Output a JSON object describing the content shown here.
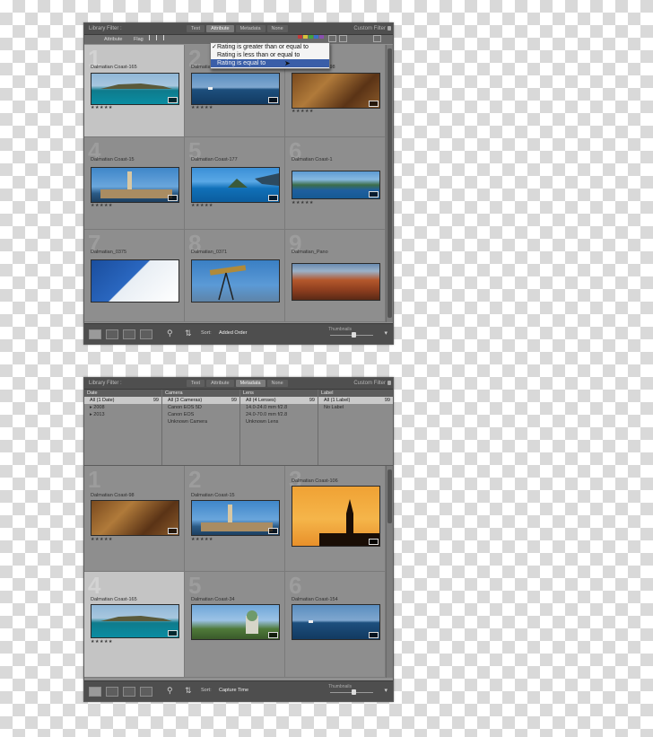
{
  "colors": {
    "panel": "#909090",
    "selected_row": "#3a5ea8",
    "selected_cell": "#c4c4c4",
    "toolbar": "#4e4e4e"
  },
  "top_panel": {
    "filter_title": "Library Filter :",
    "tabs": [
      "Text",
      "Attribute",
      "Metadata",
      "None"
    ],
    "active_tab": "Attribute",
    "preset": "Custom Filter",
    "attribute_bar": {
      "label": "Attribute",
      "flag_label": "Flag",
      "rating_label": "Rating"
    },
    "rating_menu": {
      "items": [
        "Rating is greater than or equal to",
        "Rating is less than or equal to",
        "Rating is equal to"
      ],
      "checked_index": 0,
      "selected_index": 2
    },
    "cells": [
      {
        "index": "1",
        "name": "Dalmatian Coast-165",
        "stars": "★★★★★"
      },
      {
        "index": "2",
        "name": "Dalmatian Coast-154",
        "stars": "★★★★★"
      },
      {
        "index": "3",
        "name": "Dalmatian Coast-98",
        "stars": "★★★★★"
      },
      {
        "index": "4",
        "name": "Dalmatian Coast-15",
        "stars": "★★★★★"
      },
      {
        "index": "5",
        "name": "Dalmatian Coast-177",
        "stars": "★★★★★"
      },
      {
        "index": "6",
        "name": "Dalmatian Coast-1",
        "stars": "★★★★★"
      },
      {
        "index": "7",
        "name": "Dalmatian_0375",
        "stars": ""
      },
      {
        "index": "8",
        "name": "Dalmatian_0371",
        "stars": ""
      },
      {
        "index": "9",
        "name": "Dalmatian_Pano",
        "stars": ""
      }
    ],
    "toolbar": {
      "sort_label": "Sort:",
      "sort_value": "Added Order",
      "thumbs_label": "Thumbnails"
    }
  },
  "bottom_panel": {
    "filter_title": "Library Filter :",
    "tabs": [
      "Text",
      "Attribute",
      "Metadata",
      "None"
    ],
    "active_tab": "Metadata",
    "preset": "Custom Filter",
    "columns": [
      {
        "header": "Date",
        "rows": [
          {
            "label": "All (1 Date)",
            "count": "99",
            "sel": true
          },
          {
            "label": "▸ 2008",
            "count": "",
            "sel": false
          },
          {
            "label": "▸ 2013",
            "count": "",
            "sel": false
          }
        ]
      },
      {
        "header": "Camera",
        "rows": [
          {
            "label": "All (3 Cameras)",
            "count": "99",
            "sel": true
          },
          {
            "label": "Canon EOS 5D",
            "count": "",
            "sel": false
          },
          {
            "label": "Canon EOS",
            "count": "",
            "sel": false
          },
          {
            "label": "Unknown Camera",
            "count": "",
            "sel": false
          }
        ]
      },
      {
        "header": "Lens",
        "rows": [
          {
            "label": "All (4 Lenses)",
            "count": "99",
            "sel": true
          },
          {
            "label": "14.0-24.0 mm f/2.8",
            "count": "",
            "sel": false
          },
          {
            "label": "24.0-70.0 mm f/2.8",
            "count": "",
            "sel": false
          },
          {
            "label": "Unknown Lens",
            "count": "",
            "sel": false
          }
        ]
      },
      {
        "header": "Label",
        "rows": [
          {
            "label": "All (1 Label)",
            "count": "99",
            "sel": true
          },
          {
            "label": "No Label",
            "count": "",
            "sel": false
          }
        ]
      }
    ],
    "cells": [
      {
        "index": "1",
        "name": "Dalmatian Coast-98",
        "stars": "★★★★★"
      },
      {
        "index": "2",
        "name": "Dalmatian Coast-15",
        "stars": "★★★★★"
      },
      {
        "index": "3",
        "name": "Dalmatian Coast-106",
        "stars": "★★★★★"
      },
      {
        "index": "4",
        "name": "Dalmatian Coast-165",
        "stars": "★★★★★"
      },
      {
        "index": "5",
        "name": "Dalmatian Coast-34",
        "stars": "★★★★★"
      },
      {
        "index": "6",
        "name": "Dalmatian Coast-154",
        "stars": "★★★★★"
      }
    ],
    "toolbar": {
      "sort_label": "Sort:",
      "sort_value": "Capture Time",
      "thumbs_label": "Thumbnails"
    }
  }
}
